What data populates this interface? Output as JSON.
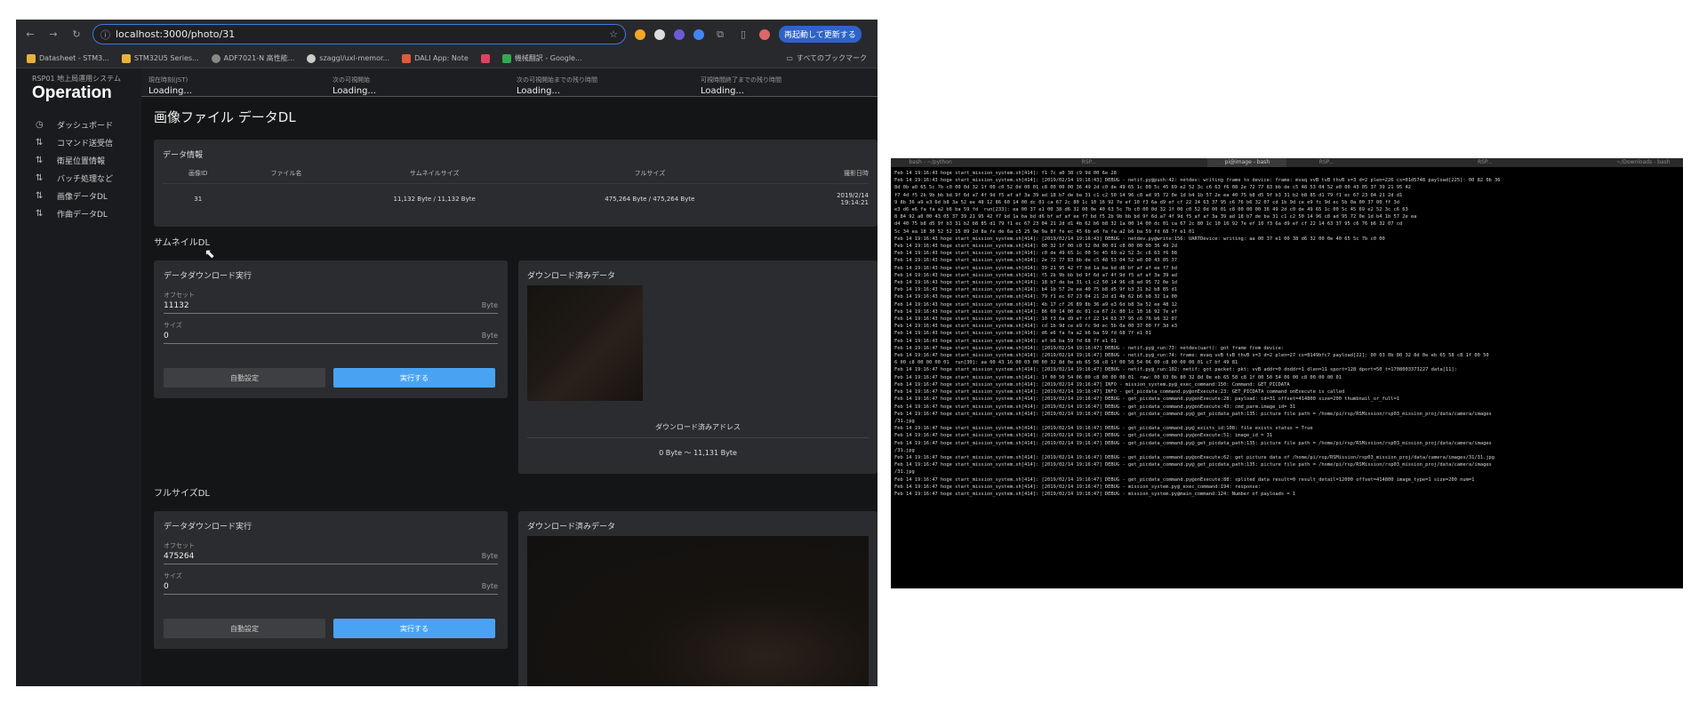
{
  "browser": {
    "url": "localhost:3000/photo/31",
    "update_button": "再起動して更新する",
    "bookmarks": [
      {
        "label": "Datasheet - STM3...",
        "color": "#e8b23a"
      },
      {
        "label": "STM32U5 Series...",
        "color": "#e8b23a"
      },
      {
        "label": "ADF7021-N 高性能...",
        "color": "#888888"
      },
      {
        "label": "szaggl/uxl-memor...",
        "color": "#cccccc"
      },
      {
        "label": "DALI App: Note",
        "color": "#e05a3c"
      },
      {
        "label": "",
        "color": "#e04060"
      },
      {
        "label": "機械翻訳 - Google...",
        "color": "#34a853"
      }
    ],
    "bookmarks_all": "すべてのブックマーク"
  },
  "app": {
    "system_name": "RSP01 地上局運用システム",
    "title": "Operation",
    "menu": [
      {
        "label": "ダッシュボード",
        "icon": "dashboard-icon",
        "glyph": "◷"
      },
      {
        "label": "コマンド送受信",
        "icon": "transfer-icon",
        "glyph": "⇅"
      },
      {
        "label": "衛星位置情報",
        "icon": "transfer-icon",
        "glyph": "⇅"
      },
      {
        "label": "バッチ処理など",
        "icon": "transfer-icon",
        "glyph": "⇅"
      },
      {
        "label": "画像データDL",
        "icon": "transfer-icon",
        "glyph": "⇅"
      },
      {
        "label": "作曲データDL",
        "icon": "transfer-icon",
        "glyph": "⇅"
      }
    ],
    "top_info": [
      {
        "label": "現在時刻(JST)",
        "value": "Loading..."
      },
      {
        "label": "次の可視開始",
        "value": "Loading..."
      },
      {
        "label": "次の可視開始までの残り時間",
        "value": "Loading..."
      },
      {
        "label": "可視時間終了までの残り時間",
        "value": "Loading..."
      }
    ]
  },
  "page": {
    "title": "画像ファイル データDL",
    "data_info": {
      "title": "データ情報",
      "headers": [
        "画像ID",
        "ファイル名",
        "サムネイルサイズ",
        "フルサイズ",
        "撮影日時"
      ],
      "row": {
        "id": "31",
        "filename": "",
        "thumb_size": "11,132 Byte / 11,132 Byte",
        "full_size": "475,264 Byte / 475,264 Byte",
        "date": "2019/2/14",
        "time": "19:14:21"
      }
    },
    "thumb": {
      "section": "サムネイルDL",
      "download_title": "データダウンロード実行",
      "offset_label": "オフセット",
      "offset_value": "11132",
      "offset_unit": "Byte",
      "size_label": "サイズ",
      "size_value": "0",
      "size_unit": "Byte",
      "auto_button": "自動設定",
      "run_button": "実行する",
      "downloaded_title": "ダウンロード済みデータ",
      "address_label": "ダウンロード済みアドレス",
      "address_range": "0 Byte 〜 11,131 Byte"
    },
    "full": {
      "section": "フルサイズDL",
      "download_title": "データダウンロード実行",
      "offset_label": "オフセット",
      "offset_value": "475264",
      "offset_unit": "Byte",
      "size_label": "サイズ",
      "size_value": "0",
      "size_unit": "Byte",
      "auto_button": "自動設定",
      "run_button": "実行する",
      "downloaded_title": "ダウンロード済みデータ"
    }
  },
  "terminal": {
    "tabs": [
      "bash - ~/python",
      "",
      "RSP...",
      "",
      "pi@image - bash",
      "RSP...",
      "",
      "RSP...",
      "",
      "~/Downloads - bash"
    ],
    "text": "Feb 14 19:16:43 hoge start_mission_system.sh[414]: f1 7c a0 38 c9 9d 00 6e 28\nFeb 14 19:16:43 hoge start_mission_system.sh[414]: [2019/02/14 19:16:43] DEBUG - netif.py@push:42: netdev: writing frame to device: frame: mvaq vvB tvB thvB s=3 d=2 plen=226 cs=01d5748 payload[225]: 00 82 0b 36\n8d 0b a0 65 5c 7b c0 00 0d 32 1f 00 c0 52 0d 00 01 c8 00 00 00 36 49 2d c0 de 49 65 1c 00 5c 45 69 e2 52 3c c6 63 f6 08 2e 72 77 83 bb de c5 48 53 04 52 e0 00 43 05 37 39 21 95 42\nf7 4d f5 2b 9b bb bd 9f 6d a7 4f 9d f5 af af 3a 39 ad 18 b7 de ba 31 c1 c2 50 14 96 c8 ad 95 72 0e 1d b4 1b 57 2e ea 40 75 b8 d5 9f b3 31 b2 b8 85 d1 79 f1 ec 67 23 04 21 2d d1\n9 8b 36 a9 e3 6d b8 3a 52 ee 48 12 86 60 14 00 dc 01 ca 67 2c 80 1c 10 16 92 7e ef 10 f3 6a d9 ef cf 22 14 63 37 95 c6 76 b6 32 07 cd 1b 9d ce e9 fc 9d ec 5b 0a 00 37 00 ff 3d\ne3 d6 e6 fa fa a2 b6 ba 59 fd  run[233]: ea 00 37 e1 00 38 d6 32 00 0e 40 63 5c 7b c0 00 0d 32 1f 00 c0 52 0d 00 01 c8 00 00 00 36 49 2d c0 de 49 65 1c 00 5c 45 69 e2 52 3c c6 63\n8 84 92 a0 00 43 05 37 39 21 95 42 f7 bd 1a ba bd d6 bf af af ee f7 bd f5 2b 9b bb bd 9f 6d a7 4f 9d f5 af af 3a 39 ad 18 b7 de ba 31 c1 c2 50 14 96 c8 ad 95 72 0e 1d b4 1b 57 2e ea\nd4 40 75 b8 d5 9f b3 31 b2 b8 85 d1 79 f1 ec 67 23 04 21 2d d1 4b 62 b6 b8 32 1a 00 14 00 dc 01 ca 67 2c 80 1c 10 16 92 7e ef 10 f3 6a d9 ef cf 22 14 63 37 95 c6 76 b6 32 07 cd\n5c 34 ea 18 30 52 52 15 89 2d 8a fe de 6a c5 25 9e 9a 8f fe ec 45 6b e6 fa fa a2 b6 ba 59 fd 68 7f e1 01\nFeb 14 19:16:43 hoge start_mission_system.sh[414]: [2019/02/14 19:16:43] DEBUG - netdev.py@write:156: UARTDevice: writing: aa 00 37 e1 00 38 d6 32 00 0e 40 65 5c 7b c0 00\nFeb 14 19:16:43 hoge start_mission_system.sh[414]: 00 32 1f 00 c0 52 0d 00 01 c8 00 00 00 36 49 2d\nFeb 14 19:16:43 hoge start_mission_system.sh[414]: c0 de 49 65 1c 00 5c 45 69 e2 52 3c c6 63 f6 08\nFeb 14 19:16:43 hoge start_mission_system.sh[414]: 2e 72 77 83 bb de c5 48 53 04 52 e0 00 43 05 37\nFeb 14 19:16:43 hoge start_mission_system.sh[414]: 39 21 95 42 f7 bd 1a ba bd d6 bf af af ee f7 bd\nFeb 14 19:16:43 hoge start_mission_system.sh[414]: f5 2b 9b bb bd 9f 6d a7 4f 9d f5 af af 3a 39 ad\nFeb 14 19:16:43 hoge start_mission_system.sh[414]: 18 b7 de ba 31 c1 c2 50 14 96 c8 ad 95 72 0e 1d\nFeb 14 19:16:43 hoge start_mission_system.sh[414]: b4 1b 57 2e ea 40 75 b8 d5 9f b3 31 b2 b8 85 d1\nFeb 14 19:16:43 hoge start_mission_system.sh[414]: 79 f1 ec 67 23 04 21 2d d1 4b 62 b6 b8 32 1a 00\nFeb 14 19:16:43 hoge start_mission_system.sh[414]: 4b 17 cf 26 89 8b 36 a9 e3 6d b8 3a 52 ee 48 12\nFeb 14 19:16:43 hoge start_mission_system.sh[414]: 86 60 14 00 dc 01 ca 67 2c 80 1c 10 16 92 7e ef\nFeb 14 19:16:43 hoge start_mission_system.sh[414]: 10 f3 6a d9 ef cf 22 14 63 37 95 c6 76 b6 32 07\nFeb 14 19:16:43 hoge start_mission_system.sh[414]: cd 1b 9d ce e9 fc 9d ec 5b 0a 00 37 00 ff 3d e3\nFeb 14 19:16:43 hoge start_mission_system.sh[414]: d6 e6 fa fa a2 b6 ba 59 fd 68 7f e1 01\nFeb 14 19:16:43 hoge start_mission_system.sh[414]: af b6 ba 59 fd 68 7f e1 01\nFeb 14 19:16:47 hoge start_mission_system.sh[414]: [2019/02/14 19:16:47] DEBUG - netif.py@_run:73: netdev(uart): got frame from device:\nFeb 14 19:16:47 hoge start_mission_system.sh[414]: [2019/02/14 19:16:47] DEBUG - netif.py@_run:74: frame: mvaq vvB tvB thvB s=3 d=2 plen=27 cs=8149bfc7 payload[22]: 00 03 0b 80 32 8d 0e eb 65 58 c8 1f 00 50\n6 00 c8 00 00 00 01  run[30]: aa 00 43 16 00 03 00 00 32 8d 0e eb 65 58 c8 1f 00 50 54 06 00 c8 00 00 00 01 c7 bf 49 81\nFeb 14 19:16:47 hoge start_mission_system.sh[414]: [2019/02/14 19:16:47] DEBUG - netif.py@_run:102: netif: got packet: pkt: vvB addr=0 dnddr=1 dlen=11 sport=128 dport=50 t=1708003373227 data[11]:\nFeb 14 19:16:47 hoge start_mission_system.sh[414]: 1f 00 50 54 06 00 c8 00 00 00 01  raw: 00 03 0b 80 32 8d 0e eb 65 58 c8 1f 00 50 54 06 00 c8 00 00 00 01\nFeb 14 19:16:47 hoge start_mission_system.sh[414]: [2019/02/14 19:16:47] INFO - mission_system.py@_exec_command:150: Command: GET_PICDATA\nFeb 14 19:16:47 hoge start_mission_system.sh[414]: [2019/02/14 19:16:47] INFO - get_picdata_command.py@onExecute:23: GET_PICDATA command onExecute is called\nFeb 14 19:16:47 hoge start_mission_system.sh[414]: [2019/02/14 19:16:47] DEBUG - get_picdata_command.py@onExecute:28: payload: id=31 offset=414800 size=200 thumbnail_or_full=1\nFeb 14 19:16:47 hoge start_mission_system.sh[414]: [2019/02/14 19:16:47] DEBUG - get_picdata_command.py@onExecute:43: cmd_parm.image_id= 31\nFeb 14 19:16:47 hoge start_mission_system.sh[414]: [2019/02/14 19:16:47] DEBUG - get_picdata_command.py@_get_picdata_path:135: picture file path = /home/pi/rsp/RSMission/rsp03_mission_proj/data/camera/images\n/31.jpg\nFeb 14 19:16:47 hoge start_mission_system.sh[414]: [2019/02/14 19:16:47] DEBUG - get_picdata_command.py@_exists_id:108: file exists status = True\nFeb 14 19:16:47 hoge start_mission_system.sh[414]: [2019/02/14 19:16:47] DEBUG - get_picdata_command.py@onExecute:51: image_id = 31\nFeb 14 19:16:47 hoge start_mission_system.sh[414]: [2019/02/14 19:16:47] DEBUG - get_picdata_command.py@_get_picdata_path:135: picture file path = /home/pi/rsp/RSMission/rsp03_mission_proj/data/camera/images\n/31.jpg\nFeb 14 19:16:47 hoge start_mission_system.sh[414]: [2019/02/14 19:16:47] DEBUG - get_picdata_command.py@onExecute:62: get picture data of /home/pi/rsp/RSMission/rsp03_mission_proj/data/camera/images/31/31.jpg\nFeb 14 19:16:47 hoge start_mission_system.sh[414]: [2019/02/14 19:16:47] DEBUG - get_picdata_command.py@_get_picdata_path:135: picture file path = /home/pi/rsp/RSMission/rsp03_mission_proj/data/camera/images\n/31.jpg\nFeb 14 19:16:47 hoge start_mission_system.sh[414]: [2019/02/14 19:16:47] DEBUG - get_picdata_command.py@onExecute:88: splited data result=0 result_detail=12000 offset=414800 image_type=1 size=200 num=1\nFeb 14 19:16:47 hoge start_mission_system.sh[414]: [2019/02/14 19:16:47] DEBUG - mission_system.py@_exec_command:194: response:\nFeb 14 19:16:47 hoge start_mission_system.sh[414]: [2019/02/14 19:16:47] DEBUG - mission_system.py@main_command:124: Number of payloads = 1"
  }
}
